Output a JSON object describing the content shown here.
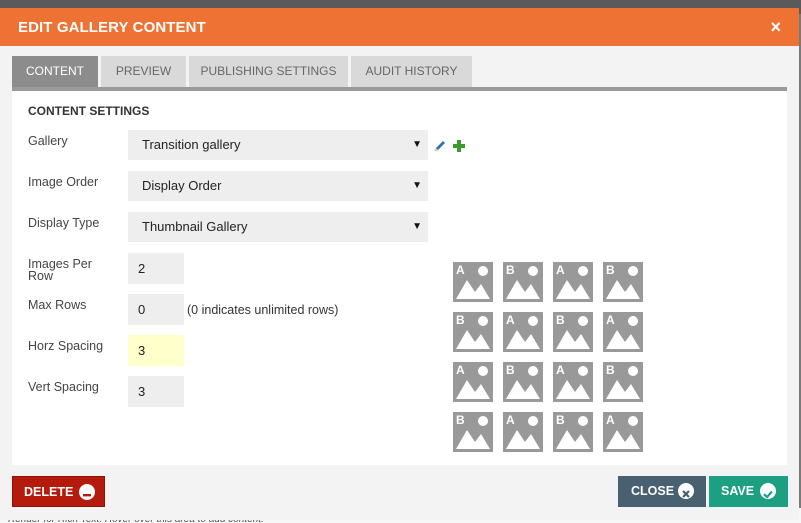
{
  "dialog": {
    "title": "EDIT GALLERY CONTENT",
    "close_glyph": "×"
  },
  "tabs": [
    {
      "label": "CONTENT",
      "active": true
    },
    {
      "label": "PREVIEW",
      "active": false
    },
    {
      "label": "PUBLISHING SETTINGS",
      "active": false
    },
    {
      "label": "AUDIT HISTORY",
      "active": false
    }
  ],
  "content": {
    "section_title": "CONTENT SETTINGS",
    "gallery": {
      "label": "Gallery",
      "value": "Transition gallery"
    },
    "image_order": {
      "label": "Image Order",
      "value": "Display Order"
    },
    "display_type": {
      "label": "Display Type",
      "value": "Thumbnail Gallery"
    },
    "images_per_row": {
      "label_line1": "Images Per",
      "label_line2": "Row",
      "value": "2"
    },
    "max_rows": {
      "label": "Max Rows",
      "value": "0",
      "hint": "(0 indicates unlimited rows)"
    },
    "horz_spacing": {
      "label": "Horz Spacing",
      "value": "3"
    },
    "vert_spacing": {
      "label": "Vert Spacing",
      "value": "3"
    },
    "caret": "▼"
  },
  "preview_grid": {
    "rows": [
      [
        "A",
        "B",
        "A",
        "B"
      ],
      [
        "B",
        "A",
        "B",
        "A"
      ],
      [
        "A",
        "B",
        "A",
        "B"
      ],
      [
        "B",
        "A",
        "B",
        "A"
      ]
    ],
    "thumb_color": "#999999"
  },
  "buttons": {
    "delete": "DELETE",
    "close": "CLOSE",
    "save": "SAVE"
  },
  "colors": {
    "title_bar": "#ee7233",
    "delete": "#b51b0d",
    "close": "#48606f",
    "save": "#1d9f82",
    "highlight_field": "#ffffcc"
  },
  "background_text": "Render for Rich Text. Hover over this area to add content."
}
